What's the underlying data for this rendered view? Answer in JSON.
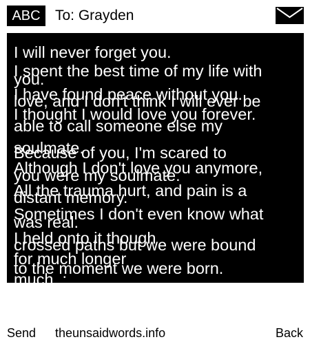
{
  "header": {
    "mode": "ABC",
    "recipient": "To: Grayden",
    "icon": "envelope-icon"
  },
  "message": {
    "lines": [
      "I will never forget you.",
      "I spent the best time of my life with",
      "you.",
      "I have found peace without you.",
      "love, and I don't think I will ever be",
      "I thought I would love you forever.",
      "able to call someone else my",
      "soulmate.",
      "Because of you, I'm scared to",
      "you were my soulmate.",
      "Although I don't love you anymore,",
      "All the trauma hurt, and pain is a",
      "distant memory.",
      "Sometimes I don't even know what",
      "was real.",
      "I held onto it though",
      "crossed paths but we were bound",
      "for much longer",
      "to the moment we were born.",
      "much. :"
    ]
  },
  "footer": {
    "send": "Send",
    "site": "theunsaidwords.info",
    "back": "Back"
  },
  "colors": {
    "background": "#ffffff",
    "panel": "#000000",
    "panel_text": "#ffffff"
  }
}
